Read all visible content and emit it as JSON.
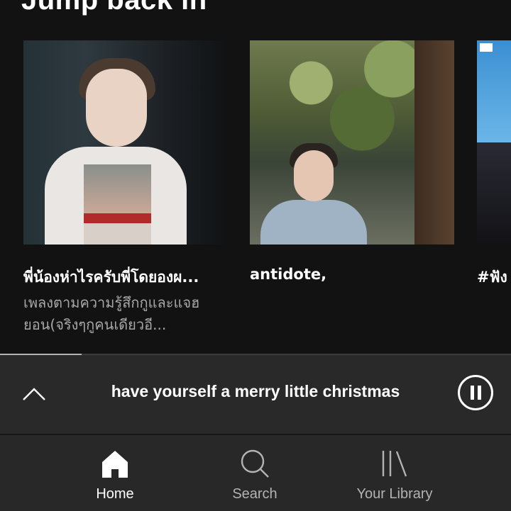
{
  "section": {
    "title": "Jump back in"
  },
  "cards": [
    {
      "title": "พี่น้องห่าไรครับพี่โดยองผ...",
      "subtitle": "เพลงตามความรู้สึกกูและแจฮยอน(จริงๆกูคนเดียวอี..."
    },
    {
      "title": "antidote,",
      "subtitle": ""
    },
    {
      "title": "#ฟัง",
      "subtitle": ""
    }
  ],
  "now_playing": {
    "title": "have yourself a merry little christmas",
    "progress": 0.16,
    "icons": {
      "expand": "chevron-up-icon",
      "pause": "pause-icon"
    }
  },
  "tabbar": {
    "items": [
      {
        "label": "Home",
        "icon": "home-icon",
        "active": true
      },
      {
        "label": "Search",
        "icon": "search-icon",
        "active": false
      },
      {
        "label": "Your Library",
        "icon": "library-icon",
        "active": false
      }
    ]
  },
  "colors": {
    "background": "#121212",
    "miniplayer": "#292929",
    "tabbar": "#282828",
    "muted_text": "#a7a7a7"
  }
}
